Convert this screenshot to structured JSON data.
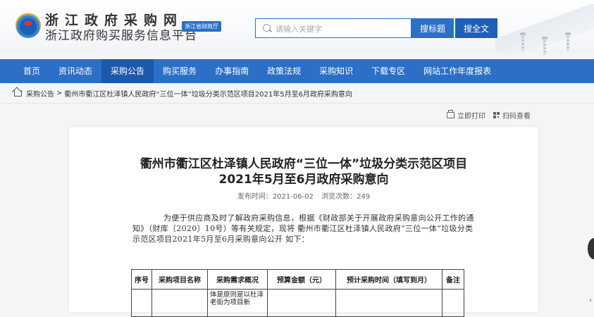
{
  "header": {
    "site_name_line1": "浙江政府采购网",
    "site_name_line2": "浙江政府购买服务信息平台",
    "badge": "浙江省财政厅",
    "search_placeholder": "请输入关键字",
    "search_title_label": "搜标题",
    "search_full_label": "搜全文"
  },
  "nav": {
    "items": [
      {
        "label": "首页",
        "active": false
      },
      {
        "label": "资讯动态",
        "active": false
      },
      {
        "label": "采购公告",
        "active": true
      },
      {
        "label": "购买服务",
        "active": false
      },
      {
        "label": "办事指南",
        "active": false
      },
      {
        "label": "政策法规",
        "active": false
      },
      {
        "label": "采购知识",
        "active": false
      },
      {
        "label": "下载专区",
        "active": false
      },
      {
        "label": "网站工作年度报表",
        "active": false
      }
    ]
  },
  "breadcrumb": {
    "root": "采购公告",
    "separator": ">",
    "current": "衢州市衢江区杜泽镇人民政府“三位一体”垃圾分类示范区项目2021年5月至6月政府采购意向"
  },
  "tools": {
    "print_label": "立即打印",
    "scan_label": "扫码查看"
  },
  "article": {
    "title_line1": "衢州市衢江区杜泽镇人民政府“三位一体”垃圾分类示范区项目",
    "title_line2": "2021年5月至6月政府采购意向",
    "publish_label": "发布时间：2021-06-02",
    "views_label": "浏览次数：249",
    "body": "为便于供应商及时了解政府采购信息，根据《财政部关于开展政府采购意向公开工作的通知》（财库〔2020〕10号）等有关规定，现将 衢州市衢江区杜泽镇人民政府“三位一体”垃圾分类示范区项目2021年5月至6月采购意向公开 如下：",
    "table": {
      "headers": [
        "序号",
        "采购项目名称",
        "采购需求概况",
        "预算金额（元）",
        "预计采购时间（填写到月）",
        "备注"
      ],
      "rows": [
        [
          "",
          "",
          "体是原则是以杜泽老街为项目新",
          "",
          "",
          ""
        ]
      ]
    }
  },
  "colors": {
    "nav_bg": "#2b6fc7",
    "nav_active": "#1e58ad",
    "search_button": "#2b6fc7"
  }
}
